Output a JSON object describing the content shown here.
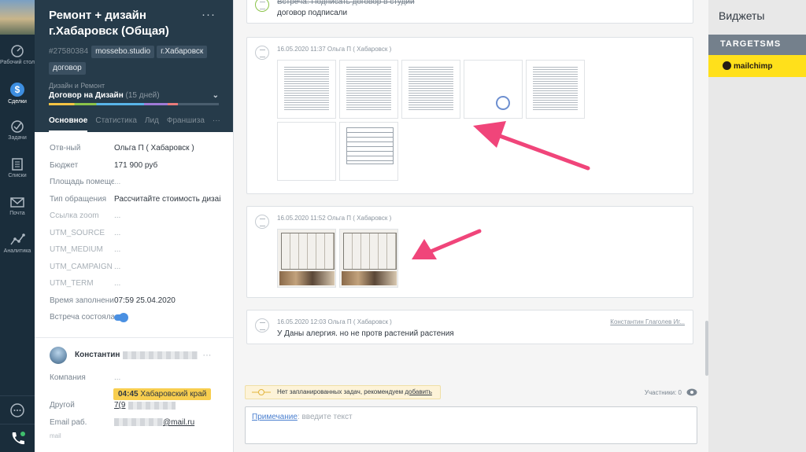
{
  "nav": {
    "items": [
      {
        "label": "Рабочий стол",
        "icon": "dashboard-icon"
      },
      {
        "label": "Сделки",
        "icon": "deals-icon"
      },
      {
        "label": "Задачи",
        "icon": "tasks-icon"
      },
      {
        "label": "Списки",
        "icon": "lists-icon"
      },
      {
        "label": "Почта",
        "icon": "mail-icon"
      },
      {
        "label": "Аналитика",
        "icon": "analytics-icon"
      }
    ]
  },
  "lead": {
    "title": "Ремонт + дизайн г.Хабаровск (Общая)",
    "more": "···",
    "id": "#27580384",
    "tags": [
      "mossebo.studio",
      "г.Хабаровск",
      "договор"
    ],
    "pipeline": "Дизайн и Ремонт",
    "stage": "Договор на Дизайн",
    "stage_days": "(15 дней)",
    "tabs": [
      "Основное",
      "Статистика",
      "Лид",
      "Франшиза",
      "···"
    ],
    "fields": [
      {
        "label": "Отв-ный",
        "value": "Ольга П ( Хабаровск )"
      },
      {
        "label": "Бюджет",
        "value": "171 900 руб"
      },
      {
        "label": "Площадь помещения",
        "value": "..."
      },
      {
        "label": "Тип обращения",
        "value": "Рассчитайте стоимость дизайн-проекта"
      },
      {
        "label": "Ссылка zoom",
        "value": "..."
      },
      {
        "label": "UTM_SOURCE",
        "value": "..."
      },
      {
        "label": "UTM_MEDIUM",
        "value": "..."
      },
      {
        "label": "UTM_CAMPAIGN",
        "value": "..."
      },
      {
        "label": "UTM_TERM",
        "value": "..."
      },
      {
        "label": "Время заполнения",
        "value": "07:59 25.04.2020"
      },
      {
        "label": "Встреча состоялась",
        "value": ""
      }
    ],
    "contact": {
      "name": "Константин",
      "more": "···",
      "tz_time": "04:45",
      "tz_label": "Хабаровский край",
      "fields": [
        {
          "label": "Компания",
          "value": "..."
        },
        {
          "label": "Другой",
          "value": "7(9"
        },
        {
          "label": "Email раб.",
          "value": "@mail.ru"
        }
      ],
      "extra": "mail"
    }
  },
  "feed": {
    "notes": [
      {
        "text_strike": "Встреча: Подписать договор в студии",
        "text": "договор подписали"
      },
      {
        "meta": "16.05.2020 11:37 Ольга П ( Хабаровск )"
      },
      {
        "meta": "16.05.2020 11:52 Ольга П ( Хабаровск )"
      },
      {
        "meta": "16.05.2020 12:03 Ольга П ( Хабаровск )",
        "author": "Константин Глаголев Иг...",
        "text": "У Даны алергия. но не протв растений растения"
      }
    ],
    "tasks_text": "Нет запланированных задач, рекомендуем",
    "tasks_link": "добавить",
    "participants": "Участники: 0",
    "composer_kind": "Примечание",
    "composer_placeholder": ": введите текст"
  },
  "widgets": {
    "title": "Виджеты",
    "targetsms": "TARGETSMS",
    "mailchimp": "mailchimp"
  },
  "colors": {
    "rail": "#1a2d3b",
    "header": "#263b4a",
    "accent": "#4a90e2",
    "arrow": "#f0457a",
    "timezone": "#f8ce4f"
  }
}
